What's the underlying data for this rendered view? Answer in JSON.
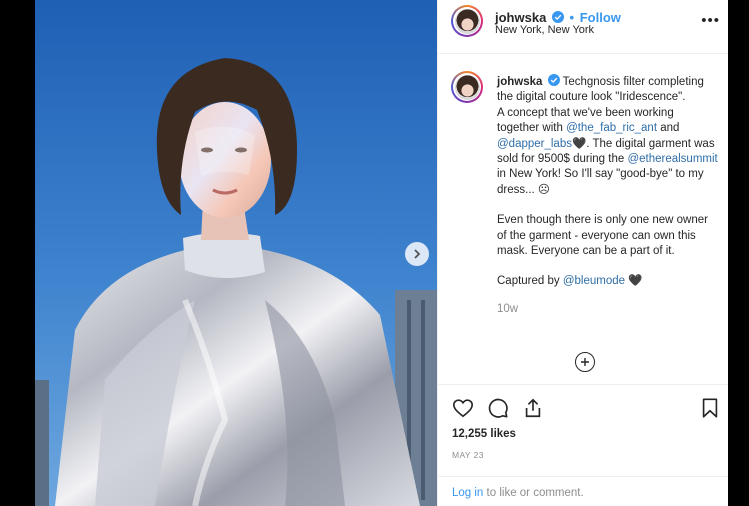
{
  "header": {
    "username": "johwska",
    "dot": "•",
    "follow_label": "Follow",
    "location": "New York, New York",
    "more_label": "•••"
  },
  "caption": {
    "username": "johwska",
    "intro": "Techgnosis filter completing the digital couture look \"Iridescence\".",
    "line2_a": "A concept that we've been working together with",
    "mention1": "@the_fab_ric_ant",
    "line2_b": "and",
    "mention2": "@dapper_labs",
    "line2_c": "🖤. The digital garment was sold for 9500$ during the",
    "mention3": "@etherealsummit",
    "line2_d": "in New York! So I'll say \"good-bye\" to my dress... ☹",
    "para2": "Even though there is only one new owner of the garment - everyone can own this mask. Everyone can be a part of it.",
    "captured_prefix": "Captured by",
    "mention4": "@bleumode",
    "captured_suffix": "🖤",
    "time_ago": "10w"
  },
  "stats": {
    "likes": "12,255 likes",
    "date": "MAY 23"
  },
  "login": {
    "link": "Log in",
    "rest": "to like or comment."
  },
  "icons": {
    "like": "heart-icon",
    "comment": "comment-icon",
    "share": "share-icon",
    "save": "bookmark-icon",
    "next": "chevron-right-icon",
    "load_more": "plus-circle-icon",
    "verified": "verified-badge-icon"
  },
  "colors": {
    "link": "#3897f0",
    "mention": "#2f6ea8",
    "text": "#262626",
    "muted": "#8e8e8e"
  }
}
